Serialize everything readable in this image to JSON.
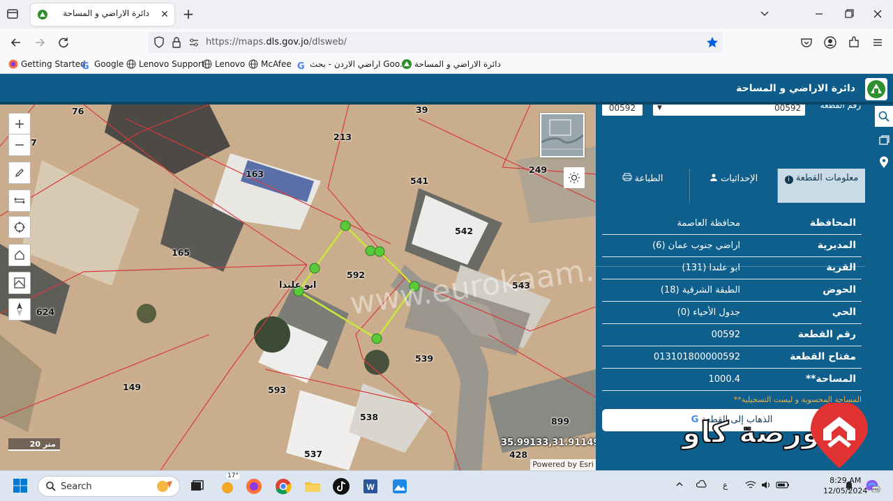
{
  "browser": {
    "tab_title": "دائرة الاراضي و المساحة",
    "url_prefix": "https://maps.",
    "url_domain": "dls.gov.jo",
    "url_suffix": "/dlsweb/",
    "new_tab_icon": "+",
    "close_icon": "✕"
  },
  "bookmarks": [
    {
      "label": "Getting Started",
      "icon": "firefox-icon"
    },
    {
      "label": "Google",
      "icon": "google-icon"
    },
    {
      "label": "Lenovo Support",
      "icon": "globe-icon"
    },
    {
      "label": "Lenovo",
      "icon": "globe-icon"
    },
    {
      "label": "McAfee",
      "icon": "globe-icon"
    },
    {
      "label": "اراضي الاردن - بحث Goo...",
      "icon": "google-icon"
    },
    {
      "label": "دائرة الاراضي و المساحة",
      "icon": "dls-logo-icon"
    }
  ],
  "app": {
    "title": "دائرة الاراضي و المساحة"
  },
  "map": {
    "parcels": [
      "76",
      "39",
      "213",
      "7",
      "163",
      "249",
      "541",
      "542",
      "165",
      "592",
      "543",
      "624",
      "539",
      "149",
      "593",
      "538",
      "899",
      "537",
      "428"
    ],
    "village_label": "ابو علندا",
    "scale": "20 متر",
    "coordinates": "35.99133,31.91149",
    "powered_by": "Powered by Esri",
    "watermark": "www.eurokaam.com"
  },
  "panel": {
    "search_label": "رقم القطعة",
    "parcel_input": "00592",
    "parcel_select": "00592",
    "tabs": {
      "info": "معلومات القطعة",
      "coords": "الإحداثيات",
      "print": "الطباعة"
    },
    "rows": [
      {
        "key": "المحافظة",
        "value": "محافظة العاصمة"
      },
      {
        "key": "المديرية",
        "value": "اراضي جنوب عمان (6)"
      },
      {
        "key": "القرية",
        "value": "ابو علندا (131)"
      },
      {
        "key": "الحوض",
        "value": "الطبقة الشرقية (18)"
      },
      {
        "key": "الحي",
        "value": "جدول الأحياء (0)"
      },
      {
        "key": "رقم القطعة",
        "value": "00592"
      },
      {
        "key": "مفتاح القطعة",
        "value": "013101800000592"
      },
      {
        "key": "**المساحة",
        "value": "1000.4"
      }
    ],
    "note": "**المساحة المحسوبة و ليست التسجيلية",
    "goto_button": "الذهاب إلى القطعة"
  },
  "brand": {
    "text": "بورصة كاو"
  },
  "taskbar": {
    "search_label": "Search",
    "weather": "17°",
    "time": "8:29 AM",
    "date": "12/05/2024",
    "lang": "ع"
  },
  "colors": {
    "header": "#0e5c8a",
    "panel": "#0f5f8c",
    "parcel_line": "#d83a3a",
    "selected_parcel": "#c8e63c",
    "vertex": "#59c93a"
  }
}
